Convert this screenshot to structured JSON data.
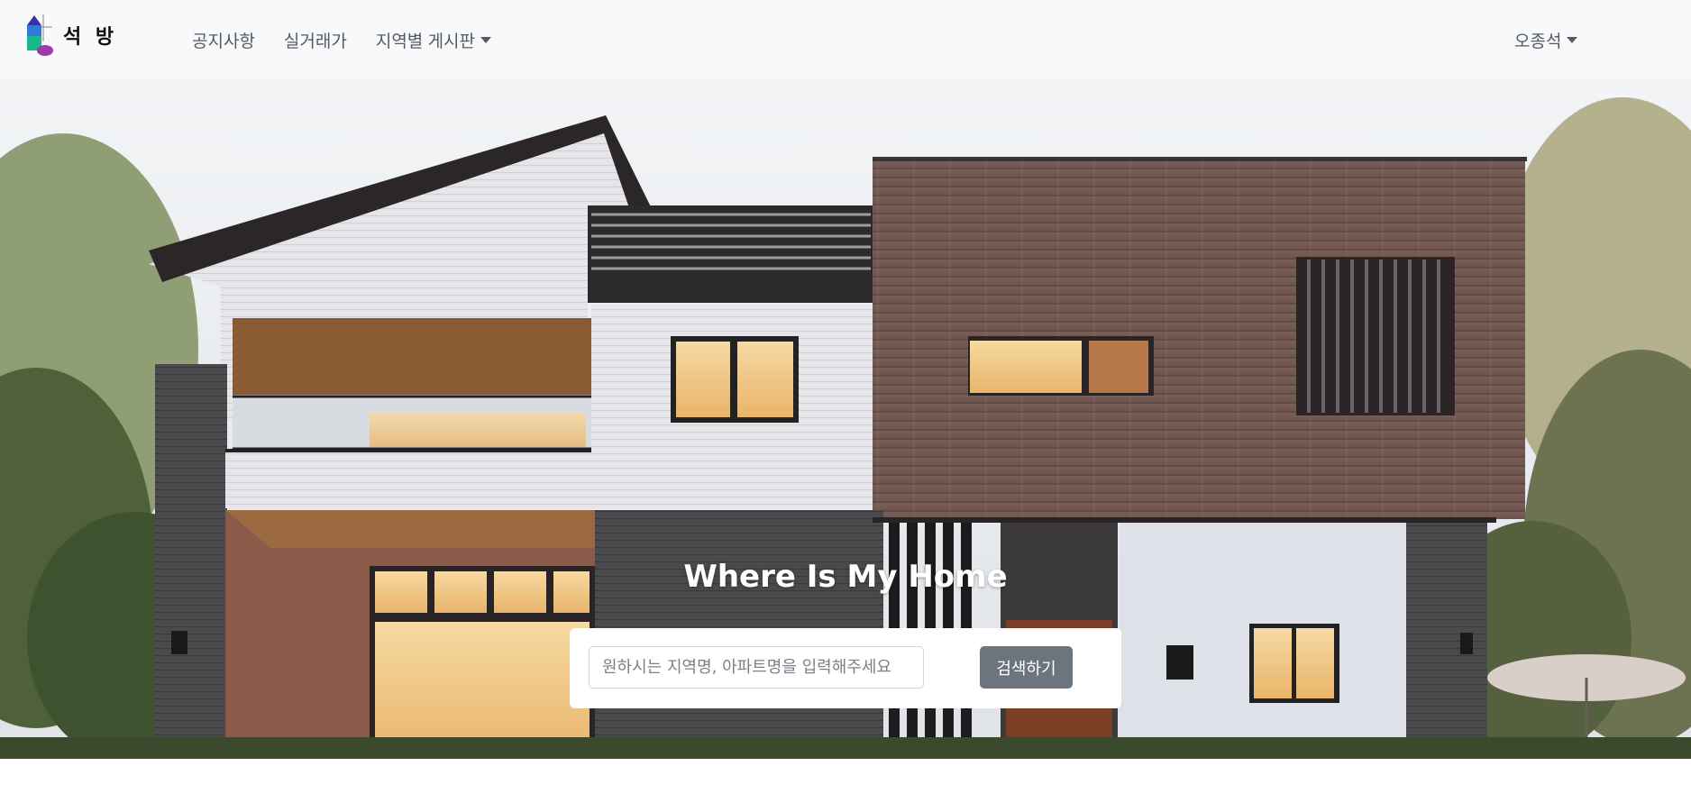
{
  "brand": {
    "name": "석 방",
    "logo_icon": "house-blocks-logo-icon"
  },
  "nav": {
    "notice": "공지사항",
    "real_price": "실거래가",
    "region_board": "지역별 게시판",
    "user_name": "오종석"
  },
  "hero": {
    "title": "Where Is My Home",
    "image": "modern-two-story-house-photo"
  },
  "search": {
    "placeholder": "원하시는 지역명, 아파트명을 입력해주세요",
    "value": "",
    "button_label": "검색하기"
  },
  "colors": {
    "navbar_bg": "#f8f9fa",
    "nav_text": "#555b61",
    "button_bg": "#6c757d",
    "button_text": "#ffffff"
  }
}
